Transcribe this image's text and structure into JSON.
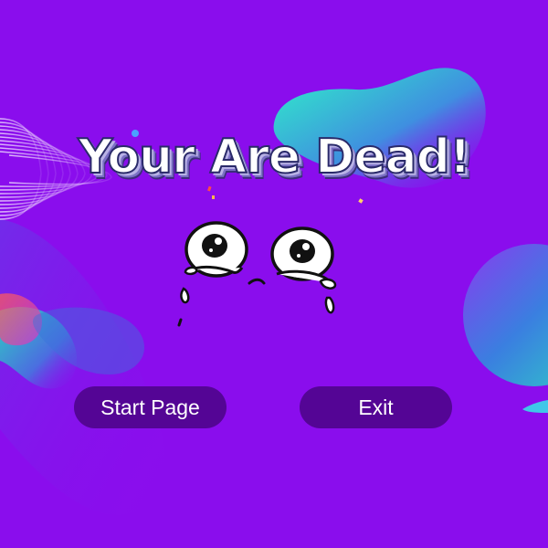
{
  "screen": {
    "title": "Your Are Dead!",
    "buttons": {
      "start_label": "Start Page",
      "exit_label": "Exit"
    }
  },
  "colors": {
    "background": "#8a0ded",
    "button": "#540595",
    "button_text": "#ffffff",
    "title_text": "#ffffff",
    "blob_teal": "#2fd5c0",
    "blob_blue": "#4a7de0"
  },
  "icons": {
    "face": "crying-face-icon"
  }
}
